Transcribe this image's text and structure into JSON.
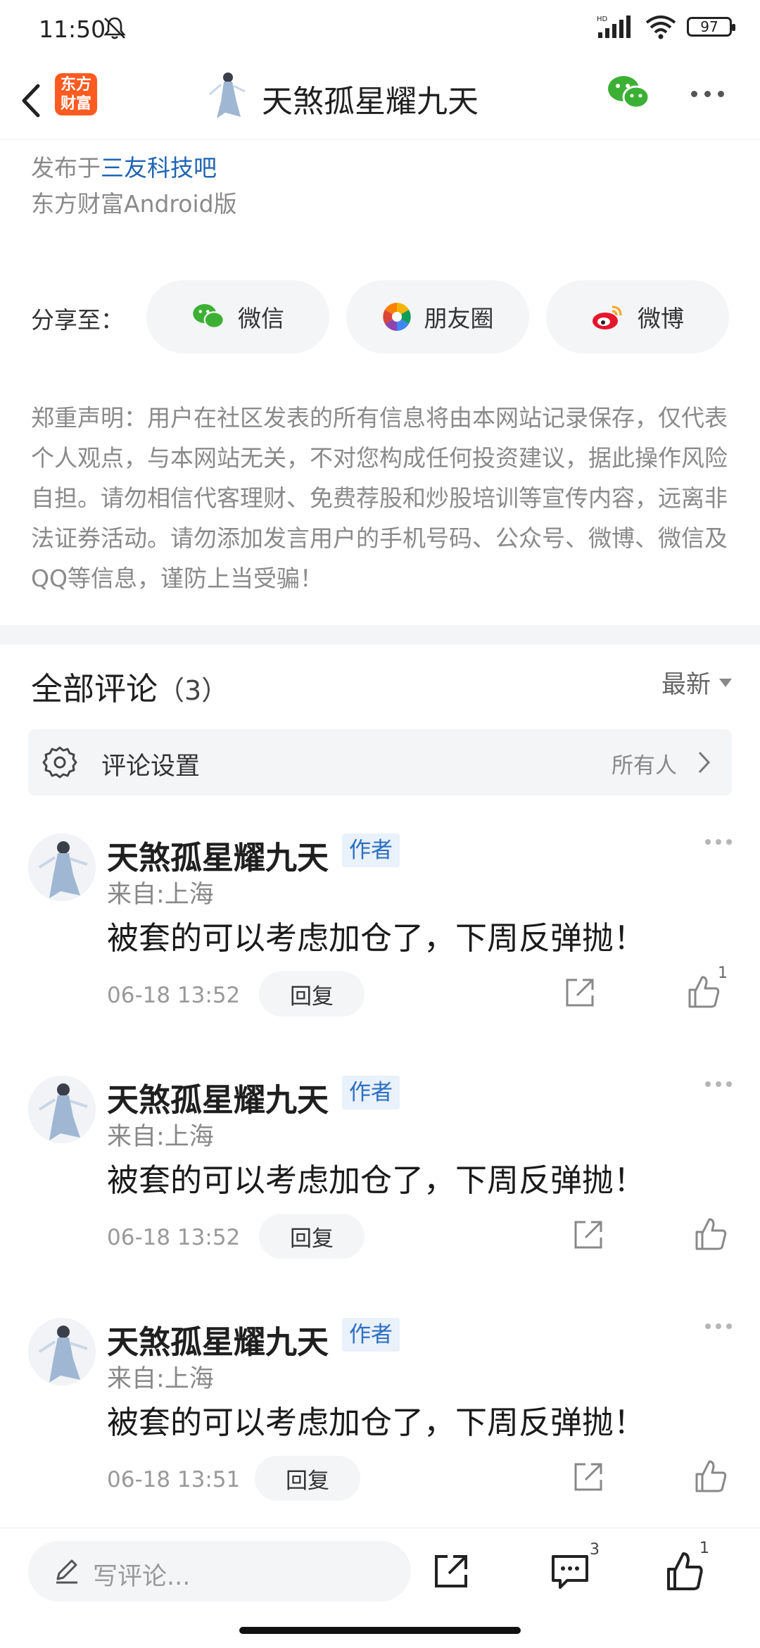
{
  "status_bar": {
    "time": "11:50",
    "battery": "97",
    "network": "HD"
  },
  "header": {
    "app_logo": "东方\n财富",
    "title": "天煞孤星耀九天"
  },
  "post_meta": {
    "posted_prefix": "发布于",
    "posted_forum": "三友科技吧",
    "client": "东方财富Android版"
  },
  "share": {
    "label": "分享至：",
    "options": [
      {
        "label": "微信",
        "icon": "wechat-icon"
      },
      {
        "label": "朋友圈",
        "icon": "moments-icon"
      },
      {
        "label": "微博",
        "icon": "weibo-icon"
      }
    ]
  },
  "disclaimer": "郑重声明：用户在社区发表的所有信息将由本网站记录保存，仅代表个人观点，与本网站无关，不对您构成任何投资建议，据此操作风险自担。请勿相信代客理财、免费荐股和炒股培训等宣传内容，远离非法证券活动。请勿添加发言用户的手机号码、公众号、微博、微信及QQ等信息，谨防上当受骗！",
  "comments_header": {
    "title": "全部评论",
    "count": "（3）",
    "sort": "最新"
  },
  "comment_settings": {
    "label": "评论设置",
    "value": "所有人"
  },
  "comments": [
    {
      "name": "天煞孤星耀九天",
      "badge": "作者",
      "location": "来自:上海",
      "text": "被套的可以考虑加仓了，下周反弹抛！",
      "time": "06-18 13:52",
      "reply": "回复",
      "likes": "1"
    },
    {
      "name": "天煞孤星耀九天",
      "badge": "作者",
      "location": "来自:上海",
      "text": "被套的可以考虑加仓了，下周反弹抛！",
      "time": "06-18 13:52",
      "reply": "回复",
      "likes": ""
    },
    {
      "name": "天煞孤星耀九天",
      "badge": "作者",
      "location": "来自:上海",
      "text": "被套的可以考虑加仓了，下周反弹抛！",
      "time": "06-18 13:51",
      "reply": "回复",
      "likes": ""
    }
  ],
  "bottom_bar": {
    "placeholder": "写评论...",
    "comment_count": "3",
    "like_count": "1"
  },
  "colors": {
    "brand": "#ff5a1f",
    "link": "#1f64b4",
    "wechat": "#3cb034",
    "weibo": "#e6162d"
  }
}
